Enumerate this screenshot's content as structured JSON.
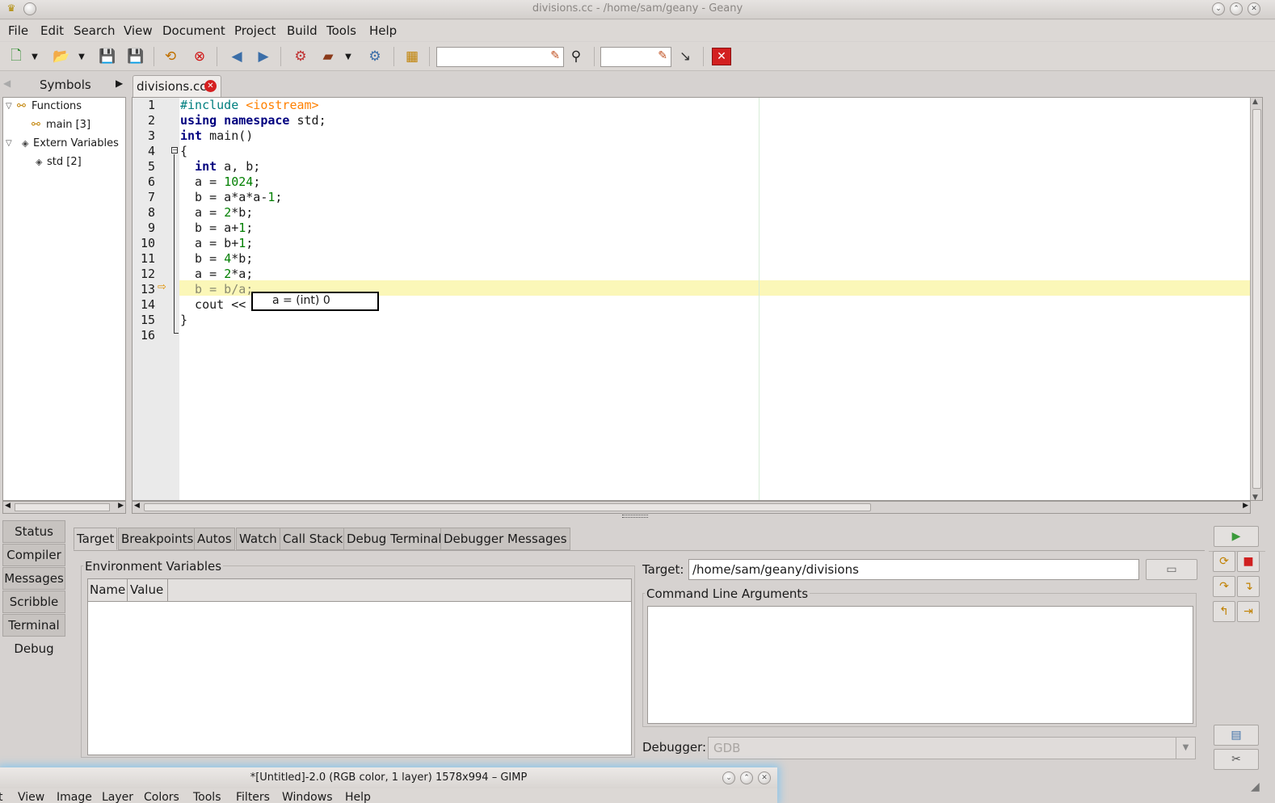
{
  "window": {
    "title": "divisions.cc - /home/sam/geany - Geany"
  },
  "menu": [
    "File",
    "Edit",
    "Search",
    "View",
    "Document",
    "Project",
    "Build",
    "Tools",
    "Help"
  ],
  "sidebar": {
    "tab_label": "Symbols",
    "tree": [
      {
        "label": "Functions",
        "child": "main [3]"
      },
      {
        "label": "Extern Variables",
        "child": "std [2]"
      }
    ]
  },
  "editor": {
    "tab_label": "divisions.cc",
    "line_numbers": [
      "1",
      "2",
      "3",
      "4",
      "5",
      "6",
      "7",
      "8",
      "9",
      "10",
      "11",
      "12",
      "13",
      "14",
      "15",
      "16"
    ],
    "current_line": 13,
    "tooltip": "a = (int) 0"
  },
  "bottom": {
    "side_tabs": [
      "Status",
      "Compiler",
      "Messages",
      "Scribble",
      "Terminal",
      "Debug"
    ],
    "active_side_tab": "Debug",
    "debug_tabs": [
      "Target",
      "Breakpoints",
      "Autos",
      "Watch",
      "Call Stack",
      "Debug Terminal",
      "Debugger Messages"
    ],
    "active_debug_tab": "Target",
    "env_label": "Environment Variables",
    "env_columns": [
      "Name",
      "Value"
    ],
    "target_label": "Target:",
    "target_value": "/home/sam/geany/divisions",
    "cmd_label": "Command Line Arguments",
    "debugger_label": "Debugger:",
    "debugger_value": "GDB"
  },
  "gimp": {
    "title": "*[Untitled]-2.0 (RGB color, 1 layer) 1578x994 – GIMP",
    "menu": [
      "t",
      "View",
      "Image",
      "Layer",
      "Colors",
      "Tools",
      "Filters",
      "Windows",
      "Help"
    ]
  }
}
